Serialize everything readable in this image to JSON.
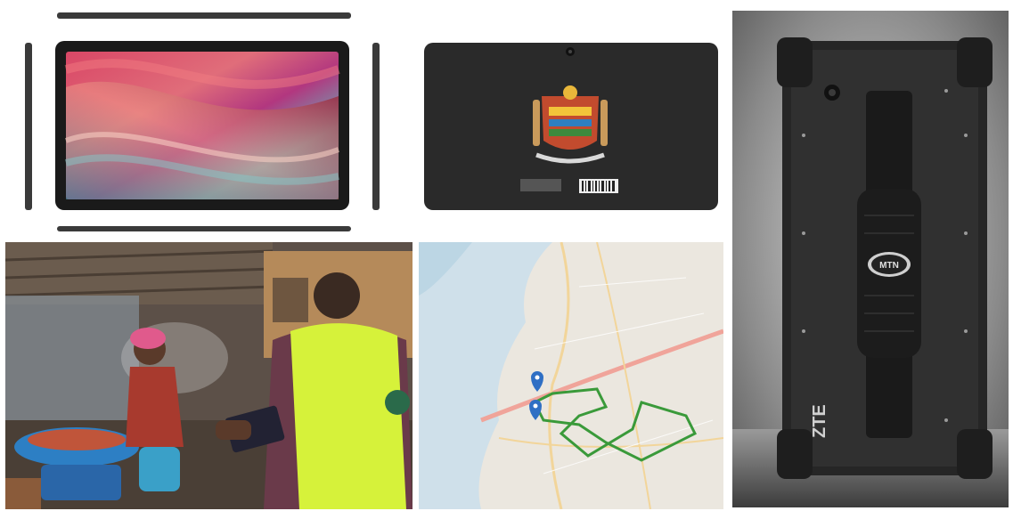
{
  "panels": {
    "tablet_front": {
      "description_icon": "tablet-front-icon"
    },
    "tablet_back": {
      "description_icon": "tablet-back-icon"
    },
    "rugged_tablet": {
      "brand_text": "ZTE",
      "badge_text": "MTN"
    },
    "field_worker": {
      "description_icon": "field-worker-icon"
    },
    "map": {
      "description_icon": "map-icon"
    }
  },
  "colors": {
    "route": "#3a9a3a",
    "pin": "#2f6fc4",
    "water": "#cfe0ea",
    "vest": "#d6f23a"
  }
}
